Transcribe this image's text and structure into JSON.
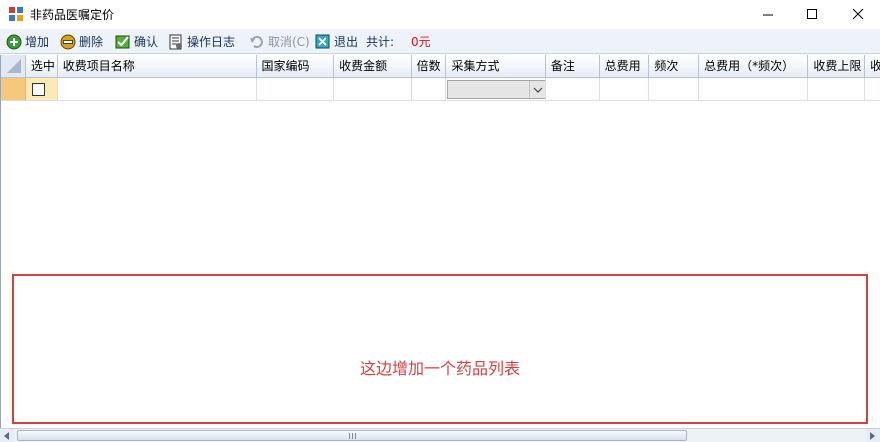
{
  "window": {
    "title": "非药品医嘱定价"
  },
  "toolbar": {
    "add_label": "增加",
    "delete_label": "删除",
    "confirm_label": "确认",
    "log_label": "操作日志",
    "cancel_label": "取消(C)",
    "exit_label": "退出",
    "total_label": "共计:",
    "total_value": "0元"
  },
  "grid": {
    "columns": [
      "选中",
      "收费项目名称",
      "国家编码",
      "收费金额",
      "倍数",
      "采集方式",
      "备注",
      "总费用",
      "频次",
      "总费用（*频次）",
      "收费上限",
      "收"
    ],
    "rows": [
      {
        "selected": false,
        "item_name": "",
        "national_code": "",
        "amount": "",
        "multiple": "",
        "collect_method": "",
        "remark": "",
        "total_fee": "",
        "frequency": "",
        "total_fee_freq": "",
        "fee_limit": ""
      }
    ]
  },
  "annotation": {
    "text": "这边增加一个药品列表",
    "color": "#d84040"
  },
  "colors": {
    "toolbar_bg": "#eef3fa",
    "header_bg": "#e7edf6",
    "row_selected": "#fde9b4",
    "total_value": "#e01010"
  }
}
